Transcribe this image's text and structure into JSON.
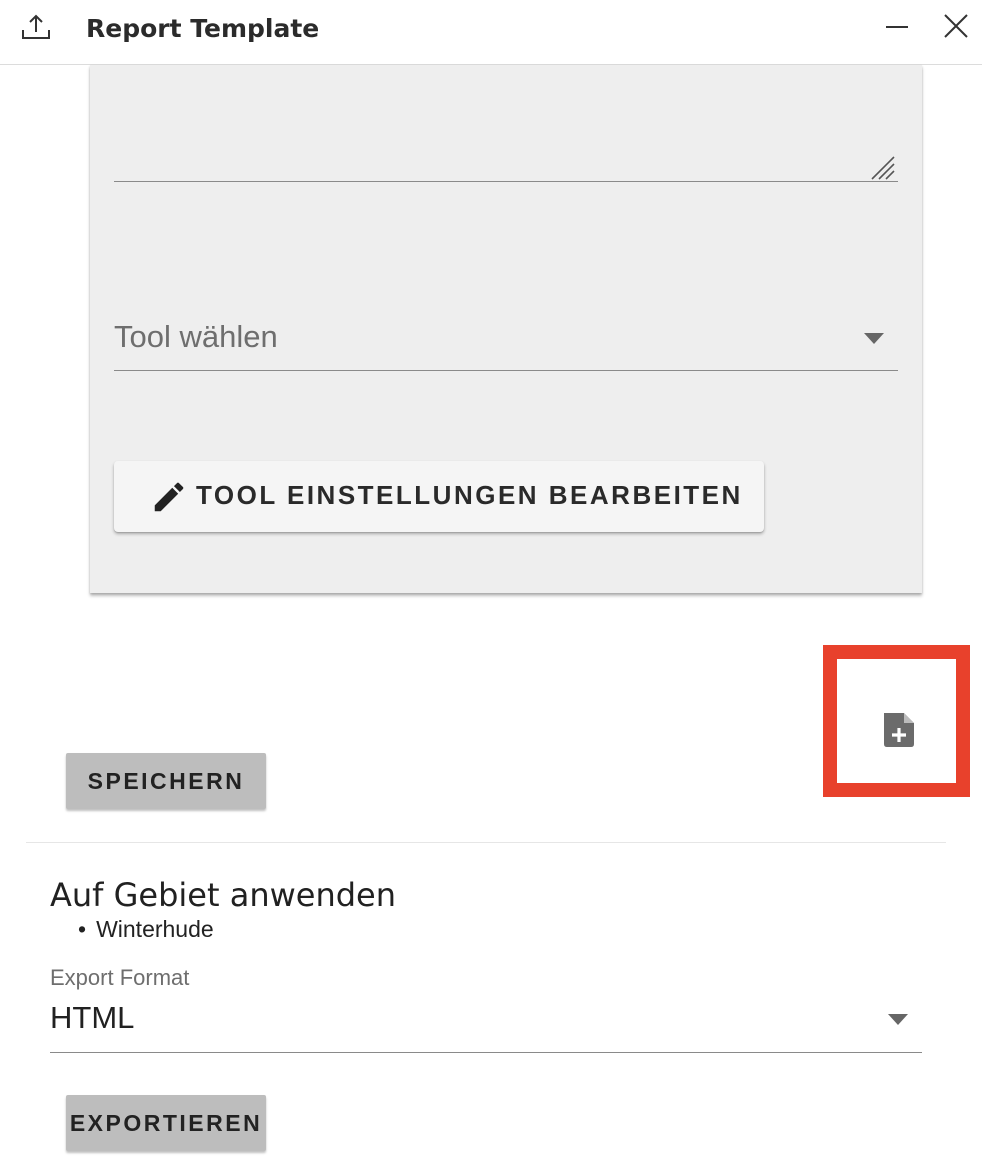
{
  "window": {
    "title": "Report Template"
  },
  "template_card": {
    "description_value": "",
    "tool_select": {
      "placeholder": "Tool wählen"
    },
    "edit_tool_button_label": "TOOL EINSTELLUNGEN BEARBEITEN"
  },
  "actions": {
    "save_label": "SPEICHERN",
    "add_template_icon": "note-add-icon"
  },
  "apply_section": {
    "title": "Auf Gebiet anwenden",
    "areas": [
      "Winterhude"
    ]
  },
  "export": {
    "format_label": "Export Format",
    "format_value": "HTML",
    "export_label": "EXPORTIEREN"
  },
  "colors": {
    "highlight": "#e8412c",
    "card_background": "#eeeeee",
    "flat_button": "#bdbdbd"
  }
}
